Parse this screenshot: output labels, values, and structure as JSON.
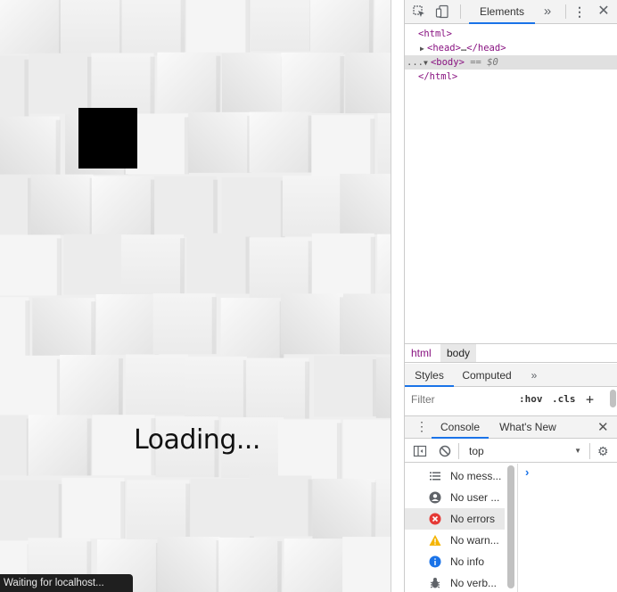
{
  "page": {
    "loading_text": "Loading...",
    "status_text": "Waiting for localhost..."
  },
  "devtools": {
    "main_tab": "Elements",
    "more_tabs_glyph": "»",
    "dom": {
      "line1": "<html>",
      "line2_open": "<head>",
      "line2_ellipsis": "…",
      "line2_close": "</head>",
      "line3_dots": "...",
      "line3_tag": "<body>",
      "line3_ref": "== $0",
      "line4": "</html>"
    },
    "breadcrumbs": [
      "html",
      "body"
    ],
    "styles": {
      "tab_styles": "Styles",
      "tab_computed": "Computed",
      "filter_placeholder": "Filter",
      "hov": ":hov",
      "cls": ".cls",
      "add": "+"
    },
    "drawer": {
      "tab_console": "Console",
      "tab_whatsnew": "What's New",
      "context": "top"
    },
    "console_sidebar": [
      {
        "label": "No mess...",
        "icon": "list-icon",
        "color": "#5f6368"
      },
      {
        "label": "No user ...",
        "icon": "user-icon",
        "color": "#5f6368"
      },
      {
        "label": "No errors",
        "icon": "error-icon",
        "color": "#e53935"
      },
      {
        "label": "No warn...",
        "icon": "warning-icon",
        "color": "#f4b400"
      },
      {
        "label": "No info",
        "icon": "info-icon",
        "color": "#1a73e8"
      },
      {
        "label": "No verb...",
        "icon": "bug-icon",
        "color": "#5f6368"
      }
    ],
    "prompt_glyph": "›"
  }
}
